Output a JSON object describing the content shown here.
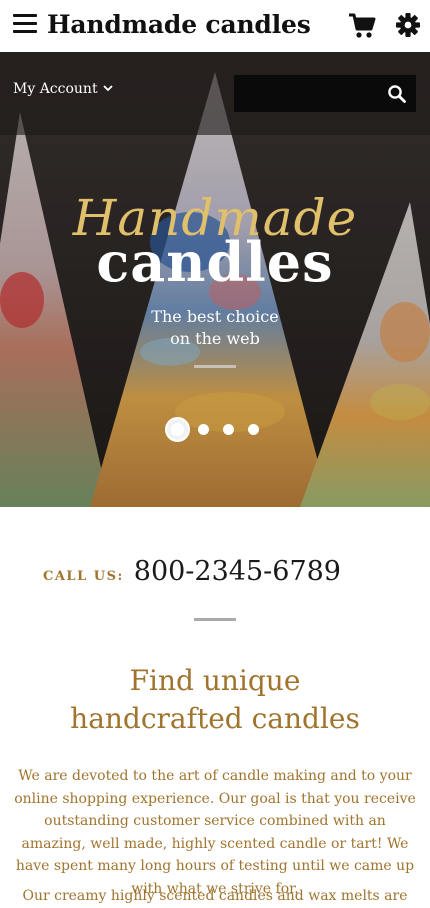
{
  "header": {
    "title": "Handmade candles",
    "menu_icon": "hamburger-menu-icon",
    "cart_icon": "shopping-cart-icon",
    "settings_icon": "gear-icon"
  },
  "account": {
    "label": "My Account"
  },
  "search": {
    "placeholder": "",
    "icon": "search-icon"
  },
  "hero": {
    "script_text": "Handmade",
    "main_text": "candles",
    "sub_line1": "The best choice",
    "sub_line2": "on the web",
    "slides": 4,
    "active_slide": 1
  },
  "contact": {
    "label": "CALL US:",
    "phone": "800-2345-6789"
  },
  "about": {
    "heading_line1": "Find unique",
    "heading_line2": "handcrafted candles",
    "paragraph": "We are devoted to the art of candle making and to your online shopping experience. Our goal is that you receive outstanding customer service combined with an amazing, well made, highly scented candle or tart! We have spent many long hours of testing until we came up with what we strive for.",
    "paragraph2": "Our creamy highly scented candles and wax melts are"
  },
  "colors": {
    "accent": "#a0742e",
    "script": "#e0c06a",
    "search_bg": "#0a0a0a"
  }
}
